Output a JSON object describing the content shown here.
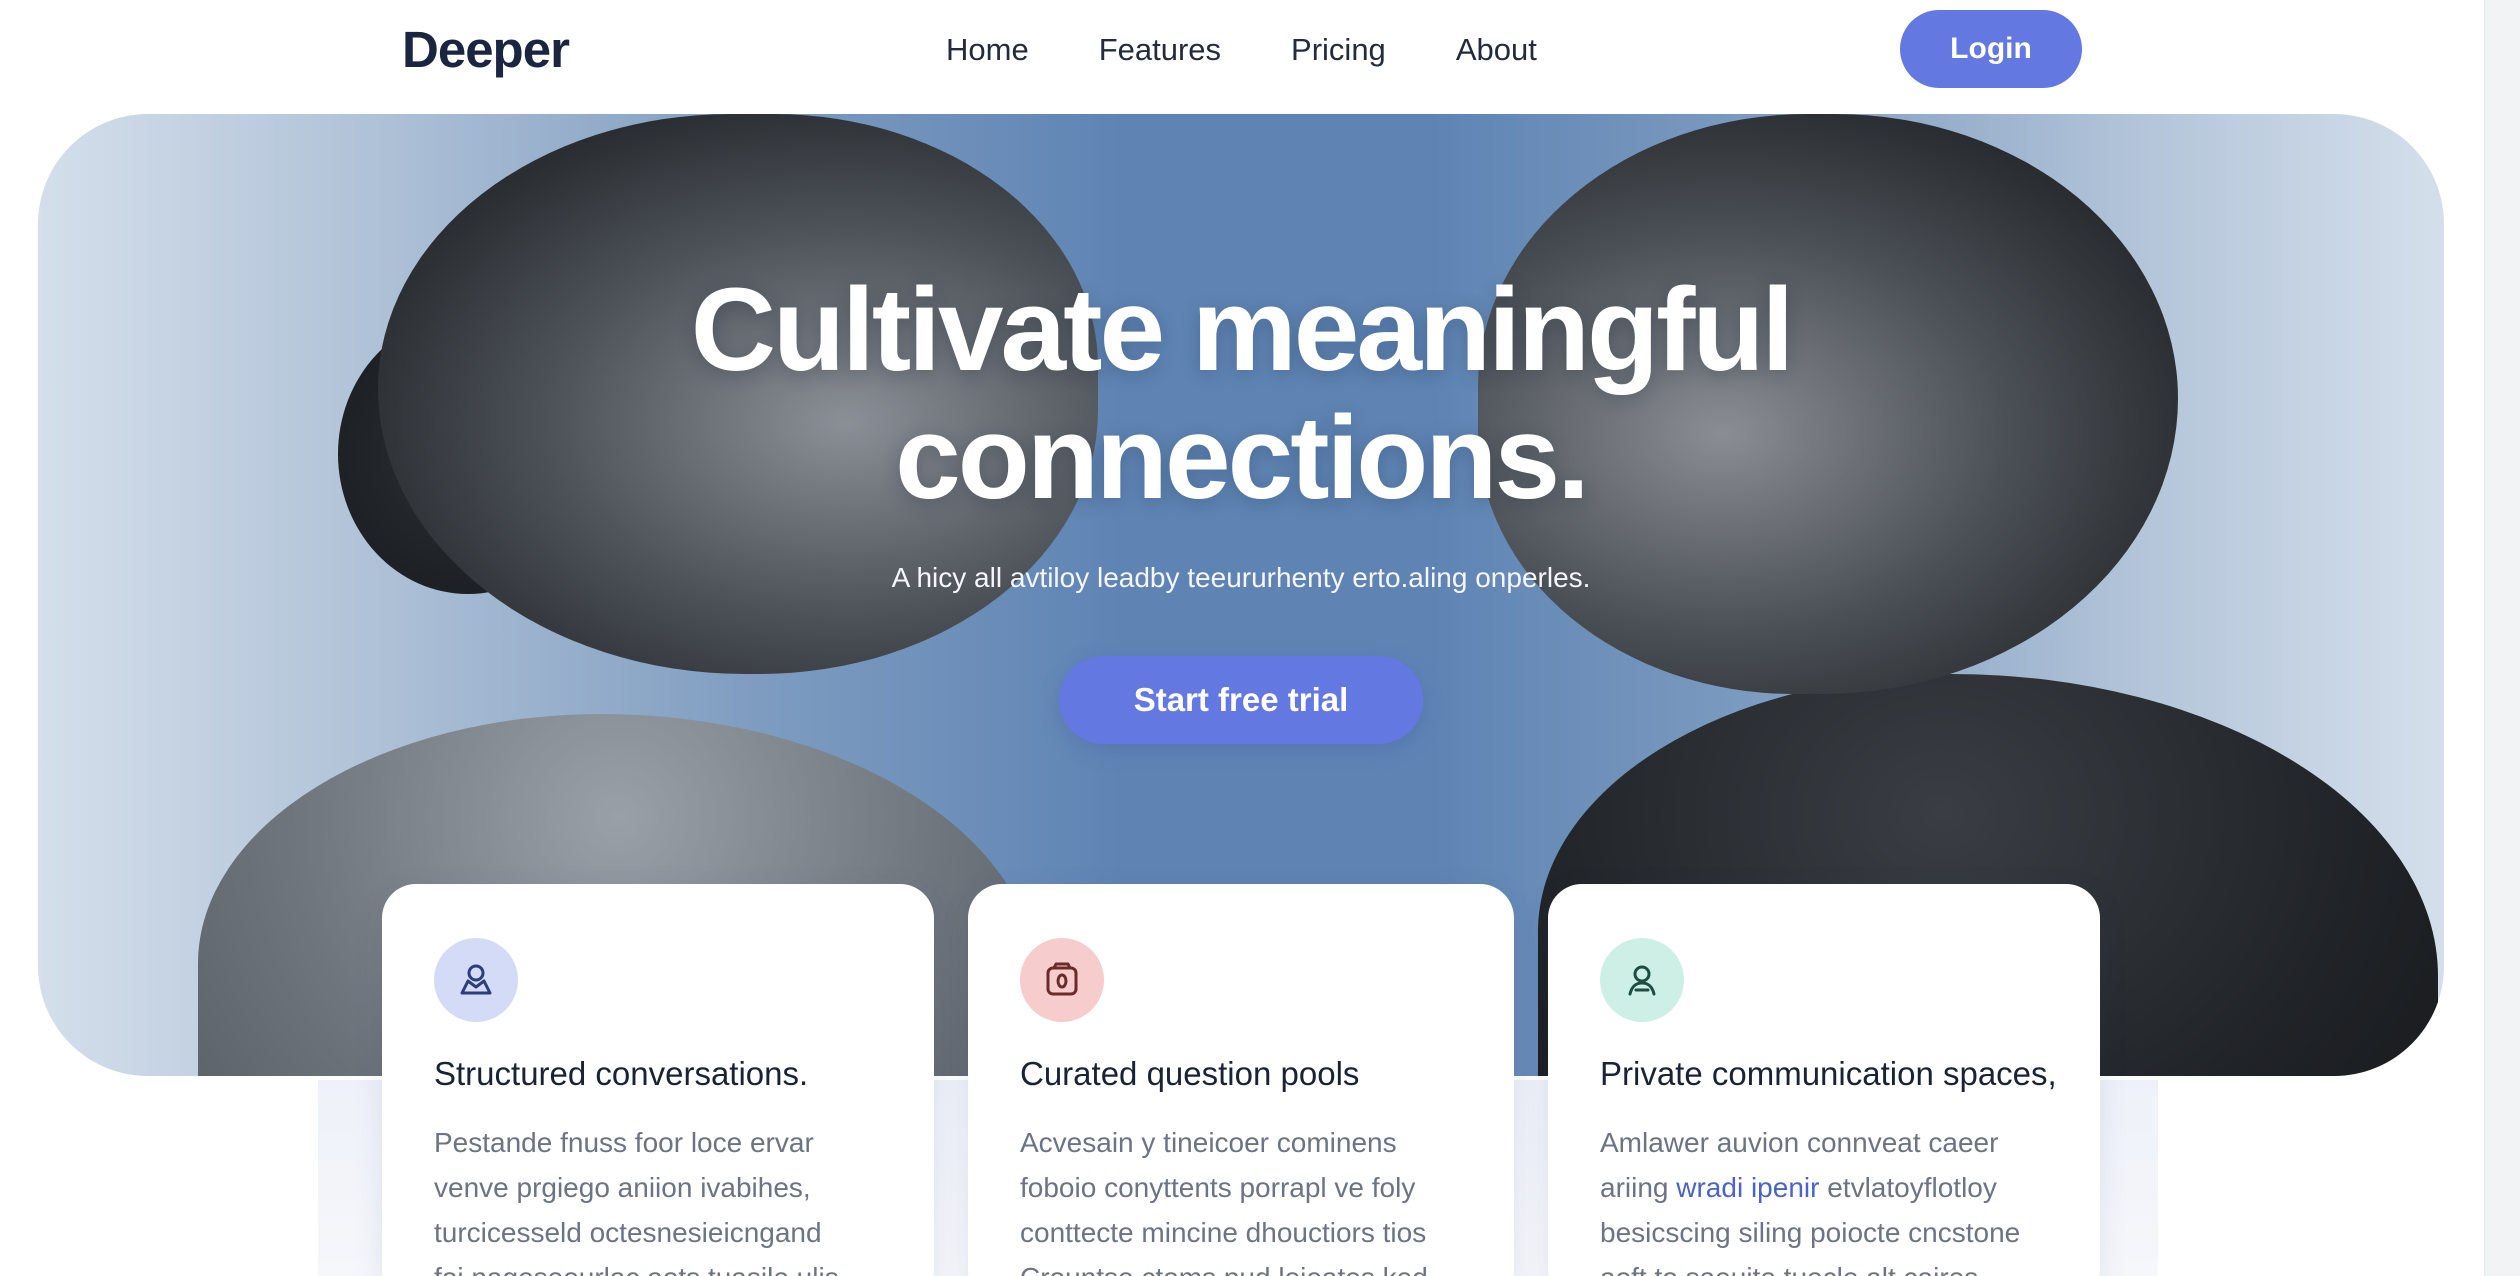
{
  "nav": {
    "logo": "Deeper",
    "links": [
      "Home",
      "Features",
      "Pricing",
      "About"
    ],
    "login_label": "Login"
  },
  "hero": {
    "title_line1": "Cultivate meaningful",
    "title_line2": "connections.",
    "subtitle": "A hicy all avtiloy leadby teeururhenty erto.aling onperles.",
    "cta_label": "Start free trial"
  },
  "features": [
    {
      "icon": "conversation-icon",
      "icon_bg": "#d3dbf6",
      "icon_color": "#2e3c7a",
      "title": "Structured conversations.",
      "body": [
        "Pestande fnuss foor loce ervar",
        "venve prgiego aniion ivabihes,",
        "turcicesseld octesnesieicngand",
        "foi nageseourlac aots tuasile ulis"
      ]
    },
    {
      "icon": "question-card-icon",
      "icon_bg": "#f7cccc",
      "icon_color": "#6b2b2b",
      "title": "Curated question pools",
      "body": [
        "Acvesain y tineicoer cominens",
        "foboio conyttents porrapl ve foly",
        "conttecte mincine dhouctiors tios",
        "Crountse ctoms pud loieates ked"
      ]
    },
    {
      "icon": "private-user-icon",
      "icon_bg": "#cdefe6",
      "icon_color": "#1f4d42",
      "title": "Private communication spaces,",
      "body_line1": "Amlawer auvion connveat caeer",
      "body_line2_a": "ariing ",
      "body_line2_hl": "wradi ipenir",
      "body_line2_b": " etvlatoyflotloy",
      "body_line3": "besicscing siling poiocte cncstone",
      "body_line4": "aoft to saeuite tuecle alt caires"
    }
  ]
}
